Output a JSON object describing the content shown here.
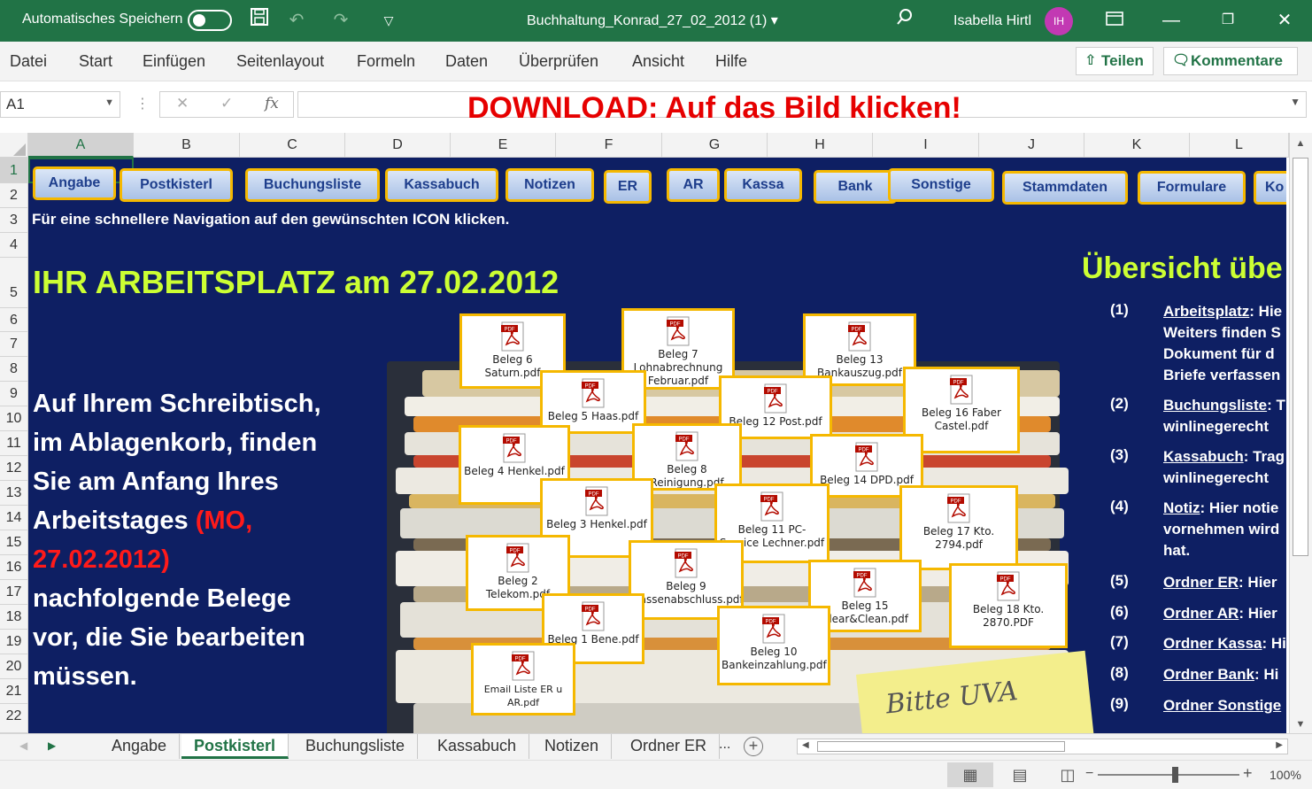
{
  "titlebar": {
    "autosave_label": "Automatisches Speichern",
    "document_title": "Buchhaltung_Konrad_27_02_2012 (1)",
    "user_name": "Isabella Hirtl",
    "user_initials": "IH"
  },
  "menu": [
    "Datei",
    "Start",
    "Einfügen",
    "Seitenlayout",
    "Formeln",
    "Daten",
    "Überprüfen",
    "Ansicht",
    "Hilfe"
  ],
  "share_label": "Teilen",
  "comments_label": "Kommentare",
  "formula_bar": {
    "name_box": "A1",
    "fx_label": "fx",
    "content": "DOWNLOAD: Auf das Bild klicken!"
  },
  "columns": [
    "A",
    "B",
    "C",
    "D",
    "E",
    "F",
    "G",
    "H",
    "I",
    "J",
    "K",
    "L"
  ],
  "rows": [
    "1",
    "2",
    "3",
    "4",
    "5",
    "6",
    "7",
    "8",
    "9",
    "10",
    "11",
    "12",
    "13",
    "14",
    "15",
    "16",
    "17",
    "18",
    "19",
    "20",
    "21",
    "22"
  ],
  "nav_buttons": [
    "Angabe",
    "Postkisterl",
    "Buchungsliste",
    "Kassabuch",
    "Notizen",
    "ER",
    "AR",
    "Kassa",
    "Bank",
    "Sonstige",
    "Stammdaten",
    "Formulare",
    "Ko"
  ],
  "nav_hint": "Für eine schnellere Navigation auf den gewünschten ICON klicken.",
  "workplace_title": "IHR ARBEITSPLATZ am 27.02.2012",
  "desk_text": {
    "line1": "Auf Ihrem Schreibtisch,",
    "line2": "im Ablagenkorb, finden",
    "line3": "Sie am Anfang Ihres",
    "line4": "Arbeitstages",
    "red1": "(MO,",
    "red2": "27.02.2012)",
    "line5": "nachfolgende Belege",
    "line6": "vor, die Sie bearbeiten",
    "line7": "müssen."
  },
  "pdf_files": [
    "Beleg 6 Saturn.pdf",
    "Beleg 7 Lohnabrechnung Februar.pdf",
    "Beleg 13 Bankauszug.pdf",
    "Beleg 5 Haas.pdf",
    "Beleg 12 Post.pdf",
    "Beleg 16 Faber Castel.pdf",
    "Beleg 4 Henkel.pdf",
    "Beleg 8 Reinigung.pdf",
    "Beleg 14 DPD.pdf",
    "Beleg 3 Henkel.pdf",
    "Beleg 11 PC-Service Lechner.pdf",
    "Beleg 17 Kto. 2794.pdf",
    "Beleg 2 Telekom.pdf",
    "Beleg 9 Kassenabschluss.pdf",
    "Beleg 15 Clear&Clean.pdf",
    "Beleg 18 Kto. 2870.PDF",
    "Beleg 1 Bene.pdf",
    "Beleg 10 Bankeinzahlung.pdf",
    "Email Liste ER u AR.pdf"
  ],
  "pdf_badge": "PDF",
  "overview": {
    "title": "Übersicht übe",
    "items": [
      {
        "num": "(1)",
        "link": "Arbeitsplatz",
        "rest": ": Hie",
        "extra": [
          "Weiters finden S",
          "Dokument für d",
          "Briefe verfassen"
        ]
      },
      {
        "num": "(2)",
        "link": "Buchungsliste",
        "rest": ": T",
        "extra": [
          "winlinegerecht"
        ]
      },
      {
        "num": "(3)",
        "link": "Kassabuch",
        "rest": ": Trag",
        "extra": [
          "winlinegerecht"
        ]
      },
      {
        "num": "(4)",
        "link": "Notiz",
        "rest": ": Hier notie",
        "extra": [
          "vornehmen wird",
          "hat."
        ]
      },
      {
        "num": "(5)",
        "link": "Ordner ER",
        "rest": ": Hier",
        "extra": []
      },
      {
        "num": "(6)",
        "link": "Ordner AR",
        "rest": ": Hier",
        "extra": []
      },
      {
        "num": "(7)",
        "link": "Ordner Kassa",
        "rest": ": Hi",
        "extra": []
      },
      {
        "num": "(8)",
        "link": "Ordner Bank",
        "rest": ": Hi",
        "extra": []
      },
      {
        "num": "(9)",
        "link": "Ordner Sonstige",
        "rest": "",
        "extra": []
      }
    ]
  },
  "sticky_text": "Bitte UVA",
  "sheet_tabs": [
    "Angabe",
    "Postkisterl",
    "Buchungsliste",
    "Kassabuch",
    "Notizen",
    "Ordner ER",
    "..."
  ],
  "active_tab": "Postkisterl",
  "zoom": "100%",
  "colors": {
    "excel_green": "#217346",
    "sheet_background": "#0e1f63",
    "highlight_green": "#ccff33",
    "accent_red": "#e60000",
    "button_border": "#f5b800"
  }
}
